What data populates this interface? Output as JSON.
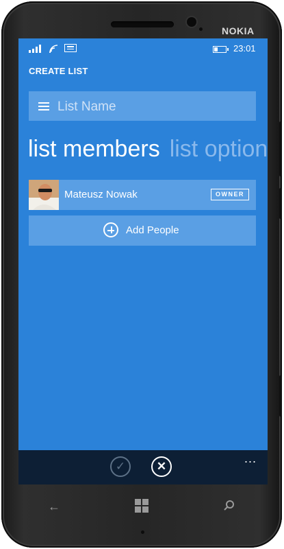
{
  "device": {
    "brand": "NOKIA"
  },
  "status_bar": {
    "time": "23:01",
    "icons": [
      "signal-icon",
      "wifi-icon",
      "message-icon",
      "battery-icon"
    ]
  },
  "page": {
    "title": "CREATE LIST"
  },
  "list_name": {
    "placeholder": "List Name",
    "value": ""
  },
  "pivot": {
    "active": "list members",
    "inactive": "list option"
  },
  "members": [
    {
      "name": "Mateusz Nowak",
      "role": "OWNER"
    }
  ],
  "add_people": {
    "label": "Add People"
  },
  "app_bar": {
    "buttons": [
      "check-icon",
      "cancel-icon"
    ],
    "more": "..."
  },
  "hardware_keys": [
    "back-icon",
    "windows-icon",
    "search-icon"
  ],
  "colors": {
    "screen_bg": "#2b82d9",
    "tile_bg": "#5a9fe4",
    "app_bar_bg": "#0d1f35",
    "pivot_inactive": "#8ab9ec"
  }
}
